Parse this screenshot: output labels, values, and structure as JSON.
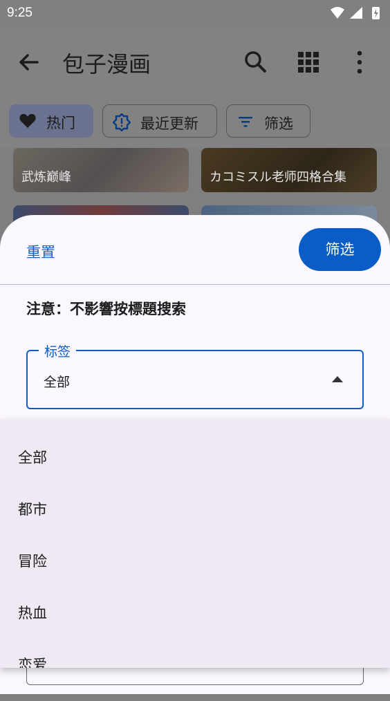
{
  "status": {
    "time": "9:25"
  },
  "appbar": {
    "title": "包子漫画",
    "icons": [
      "back-arrow-icon",
      "search-icon",
      "grid-view-icon",
      "more-vert-icon"
    ]
  },
  "chips": [
    {
      "label": "热门",
      "icon": "heart-icon",
      "selected": true
    },
    {
      "label": "最近更新",
      "icon": "update-icon",
      "selected": false
    },
    {
      "label": "筛选",
      "icon": "filter-icon",
      "selected": false
    }
  ],
  "cards": [
    {
      "title": "武炼巅峰"
    },
    {
      "title": "カコミスル老师四格合集"
    }
  ],
  "sheet": {
    "reset_label": "重置",
    "filter_label": "筛选",
    "notice": "注意：不影響按標題搜索",
    "tag_field": {
      "label": "标签",
      "value": "全部"
    }
  },
  "menu": {
    "items": [
      "全部",
      "都市",
      "冒险",
      "热血",
      "恋爱"
    ]
  },
  "colors": {
    "accent": "#0a5cc6",
    "sheet_bg": "#fbf7fe",
    "menu_bg": "#efe9f3"
  }
}
